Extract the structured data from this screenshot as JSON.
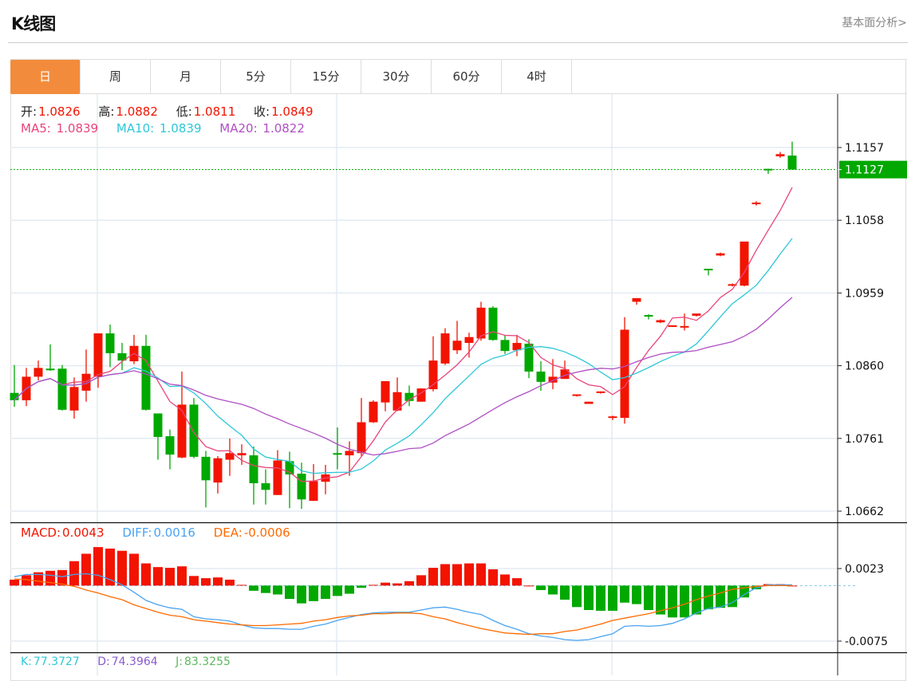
{
  "header": {
    "title": "K线图",
    "link": "基本面分析>"
  },
  "tabs": [
    {
      "label": "日",
      "active": true
    },
    {
      "label": "周"
    },
    {
      "label": "月"
    },
    {
      "label": "5分"
    },
    {
      "label": "15分"
    },
    {
      "label": "30分"
    },
    {
      "label": "60分"
    },
    {
      "label": "4时"
    }
  ],
  "ohlc_info": {
    "open_label": "开:",
    "open": "1.0826",
    "high_label": "高:",
    "high": "1.0882",
    "low_label": "低:",
    "low": "1.0811",
    "close_label": "收:",
    "close": "1.0849"
  },
  "ma_info": {
    "ma5_label": "MA5:",
    "ma5": "1.0839",
    "ma10_label": "MA10:",
    "ma10": "1.0839",
    "ma20_label": "MA20:",
    "ma20": "1.0822"
  },
  "macd_info": {
    "macd_label": "MACD:",
    "macd": "0.0043",
    "diff_label": "DIFF:",
    "diff": "0.0016",
    "dea_label": "DEA:",
    "dea": "-0.0006"
  },
  "kdj_info": {
    "k_label": "K:",
    "k": "77.3727",
    "d_label": "D:",
    "d": "74.3964",
    "j_label": "J:",
    "j": "83.3255"
  },
  "colors": {
    "up": "#f21400",
    "down": "#00a800",
    "ma5": "#e8457a",
    "ma10": "#2ec7d9",
    "ma20": "#b04fc4",
    "diff": "#4aa3f0",
    "dea": "#ff6a00",
    "accent": "#f28c3c"
  },
  "chart_data": {
    "type": "candlestick",
    "price_axis": {
      "ticks": [
        "1.1157",
        "1.1058",
        "1.0959",
        "1.0860",
        "1.0761",
        "1.0662"
      ],
      "range": [
        1.0662,
        1.1157
      ]
    },
    "current_price": "1.1127",
    "candles": [
      [
        1.0823,
        1.0861,
        1.0804,
        1.0813
      ],
      [
        1.0813,
        1.0857,
        1.0805,
        1.0845
      ],
      [
        1.0845,
        1.0867,
        1.084,
        1.0857
      ],
      [
        1.0856,
        1.0889,
        1.0853,
        1.0855
      ],
      [
        1.0856,
        1.0861,
        1.0799,
        1.08
      ],
      [
        1.0799,
        1.0844,
        1.0788,
        1.0831
      ],
      [
        1.0826,
        1.0882,
        1.0811,
        1.0849
      ],
      [
        1.0845,
        1.0904,
        1.083,
        1.0904
      ],
      [
        1.0904,
        1.0916,
        1.0858,
        1.0877
      ],
      [
        1.0877,
        1.0891,
        1.0854,
        1.0867
      ],
      [
        1.0866,
        1.0902,
        1.0862,
        1.0887
      ],
      [
        1.0887,
        1.0902,
        1.0799,
        1.08
      ],
      [
        1.0795,
        1.0795,
        1.0732,
        1.0763
      ],
      [
        1.0764,
        1.0773,
        1.0719,
        1.0739
      ],
      [
        1.0735,
        1.0852,
        1.0734,
        1.0807
      ],
      [
        1.0807,
        1.0816,
        1.0734,
        1.0736
      ],
      [
        1.0736,
        1.0744,
        1.0667,
        1.0704
      ],
      [
        1.0701,
        1.0737,
        1.0686,
        1.0734
      ],
      [
        1.0732,
        1.0761,
        1.071,
        1.0741
      ],
      [
        1.0738,
        1.0753,
        1.0725,
        1.0741
      ],
      [
        1.0738,
        1.075,
        1.0671,
        1.07
      ],
      [
        1.07,
        1.0719,
        1.0671,
        1.0691
      ],
      [
        1.0684,
        1.0745,
        1.0684,
        1.0731
      ],
      [
        1.073,
        1.0743,
        1.0666,
        1.0712
      ],
      [
        1.0713,
        1.0728,
        1.0665,
        1.0678
      ],
      [
        1.0676,
        1.0726,
        1.0676,
        1.0703
      ],
      [
        1.0702,
        1.0725,
        1.0685,
        1.0712
      ],
      [
        1.0741,
        1.0776,
        1.0719,
        1.0739
      ],
      [
        1.0738,
        1.0757,
        1.071,
        1.0744
      ],
      [
        1.0741,
        1.0816,
        1.0737,
        1.0783
      ],
      [
        1.0783,
        1.0813,
        1.0782,
        1.0811
      ],
      [
        1.081,
        1.0839,
        1.0798,
        1.0839
      ],
      [
        1.0799,
        1.0844,
        1.0798,
        1.0824
      ],
      [
        1.0823,
        1.0833,
        1.0805,
        1.0812
      ],
      [
        1.0811,
        1.0829,
        1.0811,
        1.0829
      ],
      [
        1.0828,
        1.09,
        1.0825,
        1.0867
      ],
      [
        1.0863,
        1.0911,
        1.0861,
        1.0904
      ],
      [
        1.0881,
        1.0921,
        1.0876,
        1.0894
      ],
      [
        1.0891,
        1.0905,
        1.0871,
        1.0899
      ],
      [
        1.0897,
        1.0947,
        1.0894,
        1.0939
      ],
      [
        1.0939,
        1.0941,
        1.0894,
        1.0895
      ],
      [
        1.0895,
        1.0902,
        1.0876,
        1.088
      ],
      [
        1.0881,
        1.0902,
        1.0873,
        1.0891
      ],
      [
        1.089,
        1.0896,
        1.0843,
        1.0852
      ],
      [
        1.0852,
        1.0866,
        1.0826,
        1.0838
      ],
      [
        1.0837,
        1.0869,
        1.0828,
        1.0845
      ],
      [
        1.0842,
        1.0867,
        1.0842,
        1.0855
      ],
      [
        1.0819,
        1.0821,
        1.0818,
        1.0821
      ],
      [
        1.0808,
        1.0811,
        1.0808,
        1.0811
      ],
      [
        1.0823,
        1.0825,
        1.0822,
        1.0825
      ],
      [
        1.079,
        1.0792,
        1.0786,
        1.0791
      ],
      [
        1.0789,
        1.0926,
        1.0781,
        1.0909
      ],
      [
        1.0947,
        1.0952,
        1.0943,
        1.0952
      ],
      [
        1.0929,
        1.093,
        1.0923,
        1.0927
      ],
      [
        1.0919,
        1.0923,
        1.0918,
        1.0922
      ],
      [
        1.0913,
        1.0915,
        1.0913,
        1.0915
      ],
      [
        1.0912,
        1.0931,
        1.0908,
        1.0914
      ],
      [
        1.0928,
        1.0931,
        1.0927,
        1.0931
      ],
      [
        1.0992,
        1.0992,
        1.0983,
        1.0991
      ],
      [
        1.101,
        1.1014,
        1.1009,
        1.1013
      ],
      [
        1.0969,
        1.0972,
        1.0968,
        1.0971
      ],
      [
        1.0969,
        1.1029,
        1.0968,
        1.1029
      ],
      [
        1.108,
        1.1084,
        1.1078,
        1.1082
      ],
      [
        1.1128,
        1.1128,
        1.1121,
        1.1127
      ],
      [
        1.1145,
        1.1151,
        1.1143,
        1.1148
      ],
      [
        1.1146,
        1.1165,
        1.1127,
        1.1127
      ]
    ],
    "candle_fields": [
      "open",
      "high",
      "low",
      "close"
    ],
    "ma_periods": [
      5,
      10,
      20
    ],
    "macd_axis": {
      "ticks": [
        "0.0023",
        "-0.0075"
      ],
      "range": [
        -0.0075,
        0.0023
      ]
    },
    "macd_hist": [
      0.0008,
      0.0014,
      0.0018,
      0.002,
      0.0021,
      0.0033,
      0.0043,
      0.0052,
      0.005,
      0.0047,
      0.0043,
      0.003,
      0.0025,
      0.0024,
      0.0026,
      0.0013,
      0.001,
      0.0011,
      0.0008,
      0.0001,
      -0.0007,
      -0.001,
      -0.0012,
      -0.0018,
      -0.0024,
      -0.0021,
      -0.0018,
      -0.0014,
      -0.0011,
      -0.0003,
      0.0001,
      0.0004,
      0.0003,
      0.0006,
      0.0014,
      0.0024,
      0.0029,
      0.0029,
      0.003,
      0.003,
      0.0022,
      0.0015,
      0.001,
      0.0,
      -0.0006,
      -0.0012,
      -0.0019,
      -0.0029,
      -0.0033,
      -0.0034,
      -0.0034,
      -0.0023,
      -0.0025,
      -0.0033,
      -0.0039,
      -0.0043,
      -0.0043,
      -0.0039,
      -0.0032,
      -0.003,
      -0.0029,
      -0.0016,
      -0.0005,
      0.0002,
      0.0002,
      0.0
    ],
    "diff": [
      0.0012,
      0.0015,
      0.0015,
      0.0014,
      0.0012,
      0.0015,
      0.0016,
      0.0014,
      0.0008,
      0.0001,
      -0.0009,
      -0.002,
      -0.0026,
      -0.003,
      -0.0032,
      -0.0042,
      -0.0045,
      -0.0046,
      -0.0048,
      -0.0053,
      -0.0057,
      -0.0058,
      -0.0058,
      -0.0059,
      -0.0059,
      -0.0055,
      -0.0052,
      -0.0047,
      -0.0043,
      -0.0039,
      -0.0037,
      -0.0036,
      -0.0036,
      -0.0036,
      -0.0033,
      -0.003,
      -0.0029,
      -0.0032,
      -0.0036,
      -0.0039,
      -0.0047,
      -0.0054,
      -0.0059,
      -0.0065,
      -0.0068,
      -0.007,
      -0.0073,
      -0.0074,
      -0.0073,
      -0.0069,
      -0.0065,
      -0.0055,
      -0.0054,
      -0.0055,
      -0.0054,
      -0.0051,
      -0.0045,
      -0.0037,
      -0.0031,
      -0.0029,
      -0.0023,
      -0.0012,
      -0.0003,
      0.0001,
      0.0001,
      0.0001
    ],
    "dea": [
      0.0009,
      0.0008,
      0.0006,
      0.0004,
      0.0002,
      -0.0001,
      -0.0006,
      -0.001,
      -0.0015,
      -0.0019,
      -0.0026,
      -0.0031,
      -0.0036,
      -0.004,
      -0.0042,
      -0.0046,
      -0.0048,
      -0.005,
      -0.0052,
      -0.0053,
      -0.0054,
      -0.0054,
      -0.0053,
      -0.0052,
      -0.0051,
      -0.0048,
      -0.0046,
      -0.0043,
      -0.0041,
      -0.004,
      -0.0038,
      -0.0038,
      -0.0037,
      -0.0037,
      -0.0038,
      -0.0042,
      -0.0045,
      -0.005,
      -0.0054,
      -0.0058,
      -0.0061,
      -0.0064,
      -0.0065,
      -0.0066,
      -0.0065,
      -0.0065,
      -0.0062,
      -0.006,
      -0.0056,
      -0.0052,
      -0.0047,
      -0.0044,
      -0.0041,
      -0.0038,
      -0.0034,
      -0.003,
      -0.0025,
      -0.0019,
      -0.0014,
      -0.001,
      -0.0005,
      -0.0003,
      -0.0001,
      0.0,
      0.0,
      0.0
    ]
  }
}
